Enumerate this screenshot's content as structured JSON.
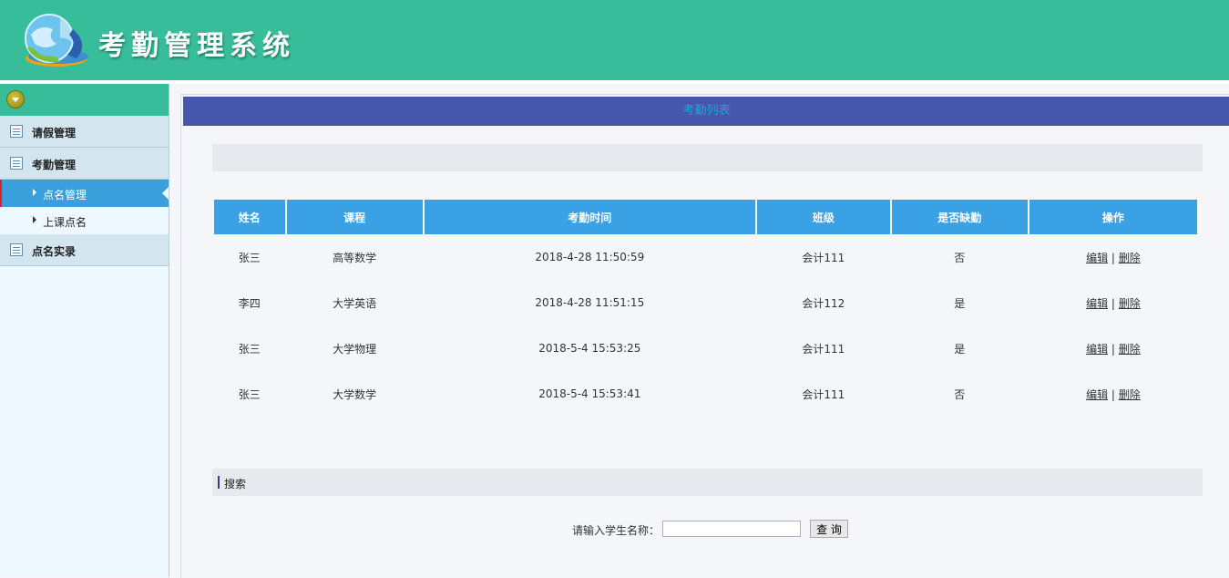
{
  "header": {
    "title": "考勤管理系统"
  },
  "sidebar": {
    "groups": [
      {
        "label": "请假管理"
      },
      {
        "label": "考勤管理",
        "items": [
          {
            "label": "点名管理",
            "active": true
          },
          {
            "label": "上课点名"
          }
        ]
      },
      {
        "label": "点名实录"
      }
    ]
  },
  "main": {
    "panel_title": "考勤列表",
    "table": {
      "headers": [
        "姓名",
        "课程",
        "考勤时间",
        "班级",
        "是否缺勤",
        "操作"
      ],
      "rows": [
        {
          "name": "张三",
          "course": "高等数学",
          "time": "2018-4-28 11:50:59",
          "class": "会计111",
          "absent": "否"
        },
        {
          "name": "李四",
          "course": "大学英语",
          "time": "2018-4-28 11:51:15",
          "class": "会计112",
          "absent": "是"
        },
        {
          "name": "张三",
          "course": "大学物理",
          "time": "2018-5-4 15:53:25",
          "class": "会计111",
          "absent": "是"
        },
        {
          "name": "张三",
          "course": "大学数学",
          "time": "2018-5-4 15:53:41",
          "class": "会计111",
          "absent": "否"
        }
      ],
      "edit_label": "编辑",
      "separator": "|",
      "delete_label": "删除"
    },
    "search": {
      "section_title": "搜索",
      "label": "请输入学生名称：",
      "input_value": "",
      "button_label": "查 询"
    }
  },
  "colors": {
    "header": "#38bd9a",
    "panel_header": "#4656ab",
    "table_header": "#3aa2e4",
    "active_item": "#3aa0dc"
  }
}
